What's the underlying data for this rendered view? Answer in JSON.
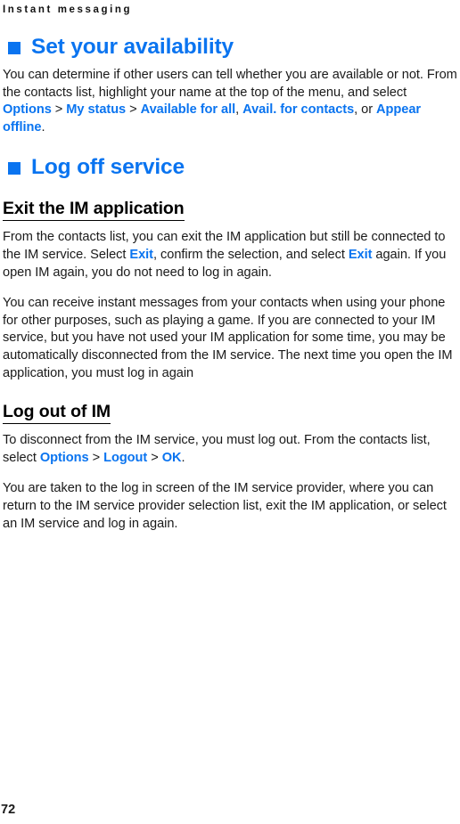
{
  "colors": {
    "accent_blue": "#0a74f0",
    "text_black": "#1a1a1a",
    "page_background": "#ffffff"
  },
  "running_header": "Instant messaging",
  "folio": "72",
  "sections": [
    {
      "id": "set-your-availability",
      "heading": "Set your availability",
      "bullet_icon": "blue-square-bullet"
    },
    {
      "id": "log-off-service",
      "heading": "Log off service",
      "bullet_icon": "blue-square-bullet"
    }
  ],
  "subheadings": {
    "exit_the_im_application": "Exit the IM application",
    "log_out_of_im": "Log out of IM"
  },
  "paragraphs": {
    "availability": {
      "part1": "You can determine if other users can tell whether you are available or not. From the contacts list, highlight your name at the top of the menu, and select ",
      "ui_options": "Options",
      "sep1": " > ",
      "ui_my_status": "My status",
      "sep2": " > ",
      "ui_available_for_all": "Available for all",
      "sep3": ", ",
      "ui_avail_for_contacts": "Avail. for contacts",
      "sep4": ", or ",
      "ui_appear_offline": "Appear offline",
      "end": "."
    },
    "exit_app": {
      "part1": "From the contacts list, you can exit the IM application but still be connected to the IM service. Select ",
      "ui_exit_1": "Exit",
      "part2": ", confirm the selection, and select ",
      "ui_exit_2": "Exit",
      "part3": " again. If you open IM again, you do not need to log in again."
    },
    "receive_messages": "You can receive instant messages from your contacts when using your phone for other purposes, such as playing a game. If you are connected to your IM service, but you have not used your IM application for some time, you may be automatically disconnected from the IM service. The next time you open the IM application, you must log in again",
    "log_out": {
      "part1": "To disconnect from the IM service, you must log out. From the contacts list, select ",
      "ui_options": "Options",
      "sep1": " > ",
      "ui_logout": "Logout",
      "sep2": " > ",
      "ui_ok": "OK",
      "end": "."
    },
    "login_screen": "You are taken to the log in screen of the IM service provider, where you can return to the IM service provider selection list, exit the IM application, or select an IM service and log in again."
  }
}
